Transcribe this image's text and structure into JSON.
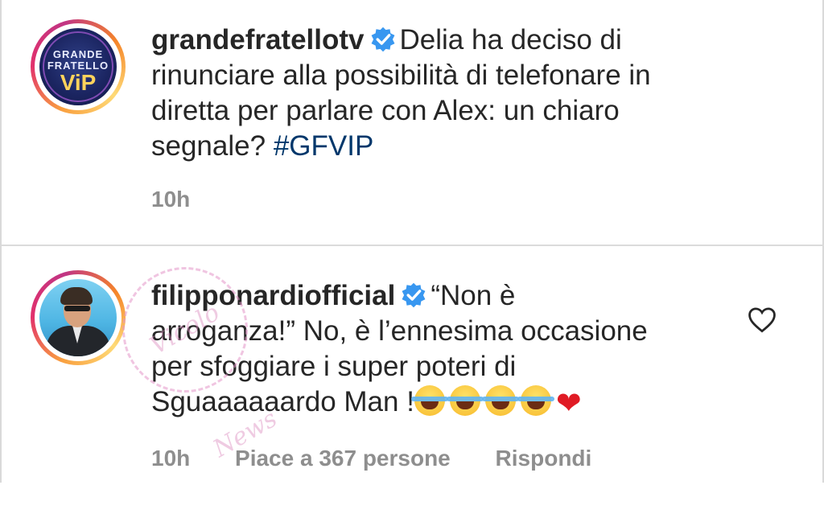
{
  "post": {
    "username": "grandefratellotv",
    "avatar_label": [
      "GRANDE",
      "FRATELLO",
      "ViP"
    ],
    "caption_text": "Delia ha deciso di rinunciare alla possibilità di telefonare in diretta per parlare con Alex: un chiaro segnale?",
    "hashtag": "#GFVIP",
    "timestamp": "10h"
  },
  "comment": {
    "username": "filipponardiofficial",
    "text_line1": "“Non è",
    "text_line2": "arroganza!” No, è l’ennesima occasione",
    "text_line3": "per sfoggiare i super poteri di",
    "text_line4": "Sguaaaaaardo Man !",
    "emojis": [
      "face-with-tears-of-joy",
      "face-with-tears-of-joy",
      "face-with-tears-of-joy",
      "face-with-tears-of-joy",
      "red-heart"
    ],
    "heart_glyph": "❤",
    "timestamp": "10h",
    "likes_label": "Piace a 367 persone",
    "reply_label": "Rispondi"
  },
  "watermark": "Vicolo News",
  "colors": {
    "verified": "#3897f0",
    "hashtag": "#00376b",
    "meta": "#8e8e8e",
    "heart": "#e01b24"
  }
}
